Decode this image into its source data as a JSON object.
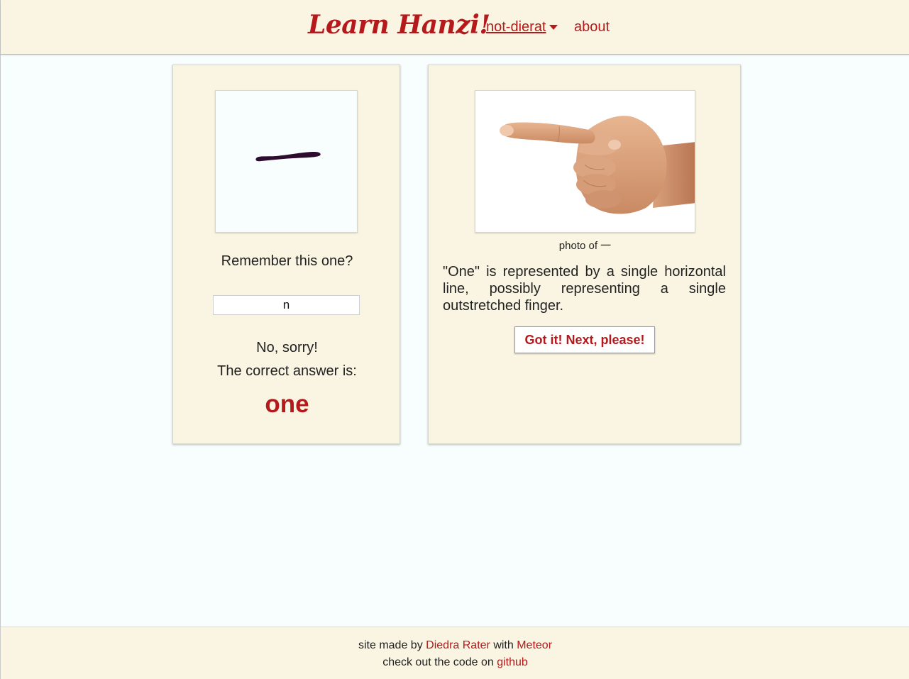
{
  "header": {
    "logo": "Learn Hanzi!",
    "user_menu": "not-dierat",
    "about": "about"
  },
  "quiz": {
    "prompt": "Remember this one?",
    "input_value": "n",
    "feedback": "No, sorry!",
    "correct_label": "The correct answer is:",
    "correct_answer": "one"
  },
  "info": {
    "caption": "photo of 一",
    "explanation": "\"One\" is represented by a single horizontal line, possibly representing a single outstretched finger.",
    "next_button": "Got it! Next, please!"
  },
  "footer": {
    "made_by_prefix": "site made by",
    "author": "Diedra Rater",
    "with_text": "with",
    "framework": "Meteor",
    "code_prefix": "check out the code on",
    "repo_link": "github"
  },
  "colors": {
    "accent": "#b5191b",
    "paper": "#faf5e2",
    "background": "#f8fefe",
    "ink": "#2e0c2e"
  },
  "icons": {
    "dropdown": "caret-down-icon"
  }
}
